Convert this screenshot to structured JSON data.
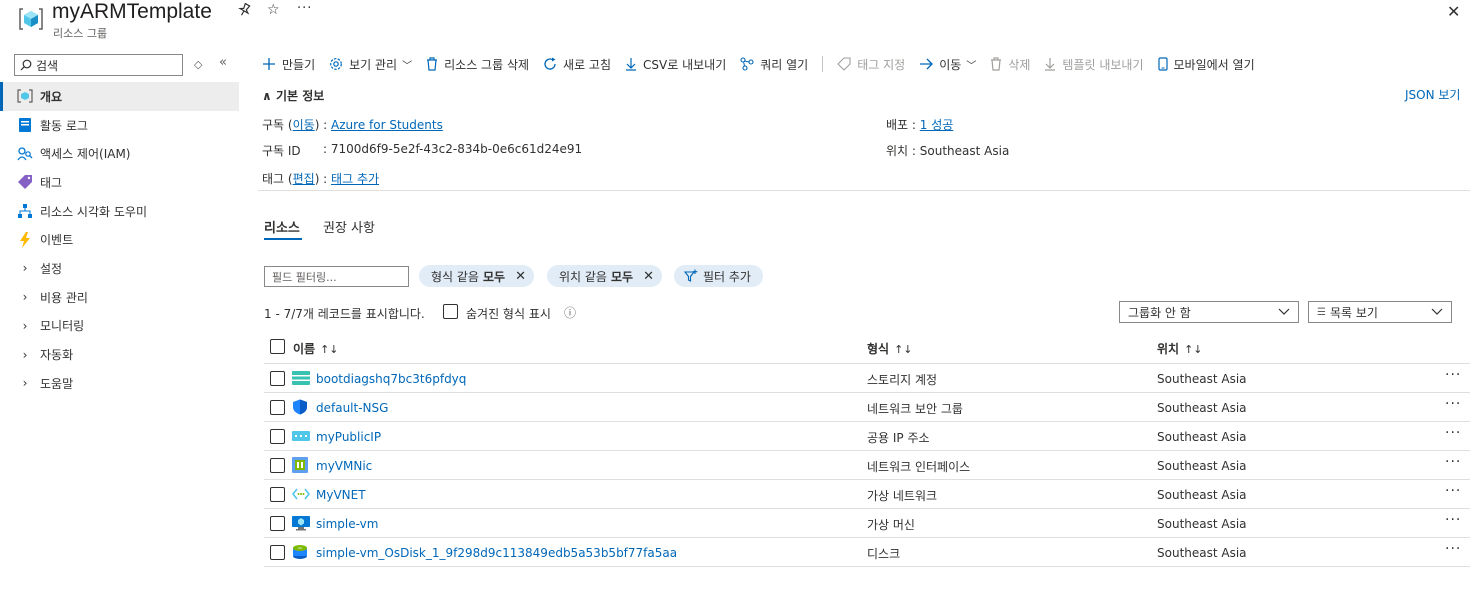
{
  "header": {
    "title": "myARMTemplate",
    "subtitle": "리소스 그룹"
  },
  "sidebar": {
    "search_placeholder": "검색",
    "items": [
      {
        "label": "개요",
        "icon": "overview-icon"
      },
      {
        "label": "활동 로그",
        "icon": "activity-log-icon"
      },
      {
        "label": "액세스 제어(IAM)",
        "icon": "iam-icon"
      },
      {
        "label": "태그",
        "icon": "tag-icon"
      },
      {
        "label": "리소스 시각화 도우미",
        "icon": "visualizer-icon"
      },
      {
        "label": "이벤트",
        "icon": "lightning-icon"
      },
      {
        "label": "설정",
        "icon": "chevron-right-icon"
      },
      {
        "label": "비용 관리",
        "icon": "chevron-right-icon"
      },
      {
        "label": "모니터링",
        "icon": "chevron-right-icon"
      },
      {
        "label": "자동화",
        "icon": "chevron-right-icon"
      },
      {
        "label": "도움말",
        "icon": "chevron-right-icon"
      }
    ]
  },
  "toolbar": {
    "create": "만들기",
    "manage_view": "보기 관리",
    "delete_group": "리소스 그룹 삭제",
    "refresh": "새로 고침",
    "export_csv": "CSV로 내보내기",
    "open_query": "쿼리 열기",
    "assign_tags": "태그 지정",
    "move": "이동",
    "delete": "삭제",
    "export_template": "템플릿 내보내기",
    "open_mobile": "모바일에서 열기"
  },
  "essentials": {
    "title": "기본 정보",
    "json_view": "JSON 보기",
    "subscription_label": "구독",
    "subscription_move": "이동",
    "subscription_value": "Azure for Students",
    "subscription_id_label": "구독 ID",
    "subscription_id_value": "7100d6f9-5e2f-43c2-834b-0e6c61d24e91",
    "tags_label": "태그",
    "tags_edit": "편집",
    "tags_value": "태그 추가",
    "deployment_label": "배포",
    "deployment_value": "1 성공",
    "location_label": "위치",
    "location_value": "Southeast Asia"
  },
  "tabs": {
    "resources": "리소스",
    "recommendations": "권장 사항"
  },
  "filters": {
    "placeholder": "필드 필터링...",
    "type_prefix": "형식 같음",
    "type_value": "모두",
    "location_prefix": "위치 같음",
    "location_value": "모두",
    "add_filter": "필터 추가"
  },
  "records": {
    "summary": "1 - 7/7개 레코드를 표시합니다.",
    "show_hidden": "숨겨진 형식 표시",
    "grouping": "그룹화 안 함",
    "view": "목록 보기"
  },
  "table": {
    "columns": [
      "이름",
      "형식",
      "위치"
    ],
    "rows": [
      {
        "name": "bootdiagshq7bc3t6pfdyq",
        "type": "스토리지 계정",
        "location": "Southeast Asia",
        "icon": "storage-icon"
      },
      {
        "name": "default-NSG",
        "type": "네트워크 보안 그룹",
        "location": "Southeast Asia",
        "icon": "shield-icon"
      },
      {
        "name": "myPublicIP",
        "type": "공용 IP 주소",
        "location": "Southeast Asia",
        "icon": "public-ip-icon"
      },
      {
        "name": "myVMNic",
        "type": "네트워크 인터페이스",
        "location": "Southeast Asia",
        "icon": "nic-icon"
      },
      {
        "name": "MyVNET",
        "type": "가상 네트워크",
        "location": "Southeast Asia",
        "icon": "vnet-icon"
      },
      {
        "name": "simple-vm",
        "type": "가상 머신",
        "location": "Southeast Asia",
        "icon": "vm-icon"
      },
      {
        "name": "simple-vm_OsDisk_1_9f298d9c113849edb5a53b5bf77fa5aa",
        "type": "디스크",
        "location": "Southeast Asia",
        "icon": "disk-icon"
      }
    ]
  },
  "colors": {
    "accent": "#0067b8",
    "pill": "#e1ecf7",
    "active_nav": "#ededed"
  }
}
